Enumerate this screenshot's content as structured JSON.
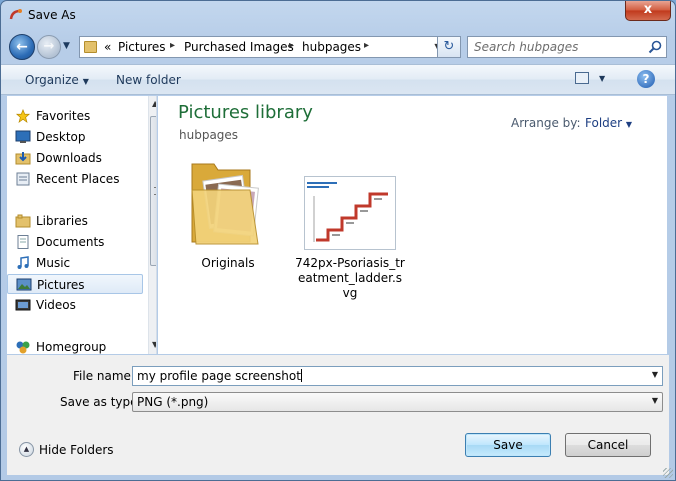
{
  "window": {
    "title": "Save As",
    "close_label": "x"
  },
  "address": {
    "crumbs": [
      "Pictures",
      "Purchased Images",
      "hubpages"
    ],
    "overflow": "«",
    "separator": "▸"
  },
  "search": {
    "placeholder": "Search hubpages"
  },
  "toolbar": {
    "organize_label": "Organize",
    "new_folder_label": "New folder",
    "help_label": "?"
  },
  "nav": {
    "favorites": {
      "label": "Favorites",
      "items": [
        "Desktop",
        "Downloads",
        "Recent Places"
      ]
    },
    "libraries": {
      "label": "Libraries",
      "items": [
        "Documents",
        "Music",
        "Pictures",
        "Videos"
      ],
      "selected": "Pictures"
    },
    "homegroup": {
      "label": "Homegroup"
    }
  },
  "content": {
    "title": "Pictures library",
    "subtitle": "hubpages",
    "arrange_label": "Arrange by:",
    "arrange_value": "Folder",
    "files": [
      {
        "line1": "Originals",
        "line2": "",
        "line3": "",
        "type": "folder"
      },
      {
        "line1": "742px-Psoriasis_tr",
        "line2": "eatment_ladder.s",
        "line3": "vg",
        "type": "svg-thumbnail"
      }
    ]
  },
  "form": {
    "file_name_label": "File name:",
    "file_name_value": "my profile page screenshot",
    "save_type_label": "Save as type:",
    "save_type_value": "PNG (*.png)"
  },
  "footer": {
    "hide_folders_label": "Hide Folders",
    "save_label": "Save",
    "cancel_label": "Cancel"
  },
  "colors": {
    "library_title": "#1e6e38",
    "link_blue": "#1e3f82",
    "window_frame": "#b7cde8"
  }
}
